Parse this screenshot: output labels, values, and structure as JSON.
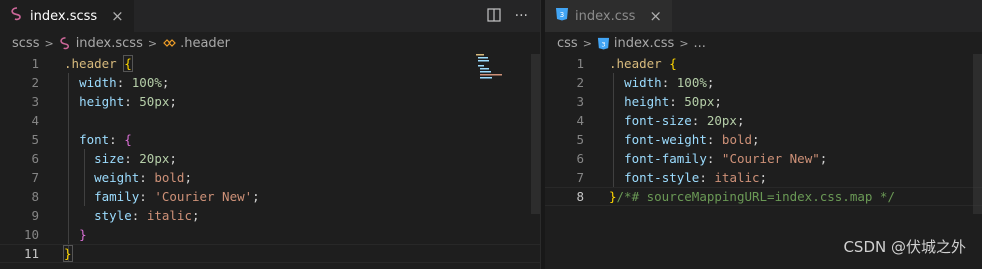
{
  "left": {
    "tab": {
      "label": "index.scss",
      "close": "×"
    },
    "actions": {
      "split": "split-editor-icon",
      "more": "···"
    },
    "breadcrumb": {
      "folder": "scss",
      "file": "index.scss",
      "symbol": ".header"
    },
    "lines": [
      [
        "1",
        ".header {"
      ],
      [
        "2",
        "  width: 100%;"
      ],
      [
        "3",
        "  height: 50px;"
      ],
      [
        "4",
        ""
      ],
      [
        "5",
        "  font: {"
      ],
      [
        "6",
        "    size: 20px;"
      ],
      [
        "7",
        "    weight: bold;"
      ],
      [
        "8",
        "    family: 'Courier New';"
      ],
      [
        "9",
        "    style: italic;"
      ],
      [
        "10",
        "  }"
      ],
      [
        "11",
        "}"
      ]
    ]
  },
  "right": {
    "tab": {
      "label": "index.css",
      "close": "×"
    },
    "breadcrumb": {
      "folder": "css",
      "file": "index.css",
      "symbol": "..."
    },
    "lines": [
      [
        "1",
        ".header {"
      ],
      [
        "2",
        "  width: 100%;"
      ],
      [
        "3",
        "  height: 50px;"
      ],
      [
        "4",
        "  font-size: 20px;"
      ],
      [
        "5",
        "  font-weight: bold;"
      ],
      [
        "6",
        "  font-family: \"Courier New\";"
      ],
      [
        "7",
        "  font-style: italic;"
      ],
      [
        "8",
        "}/*# sourceMappingURL=index.css.map */"
      ]
    ]
  },
  "watermark": "CSDN @伏城之外",
  "colors": {
    "scss_icon": "#cd6799",
    "css_icon": "#42a5f5",
    "symbol_icon": "#ee9d28"
  }
}
